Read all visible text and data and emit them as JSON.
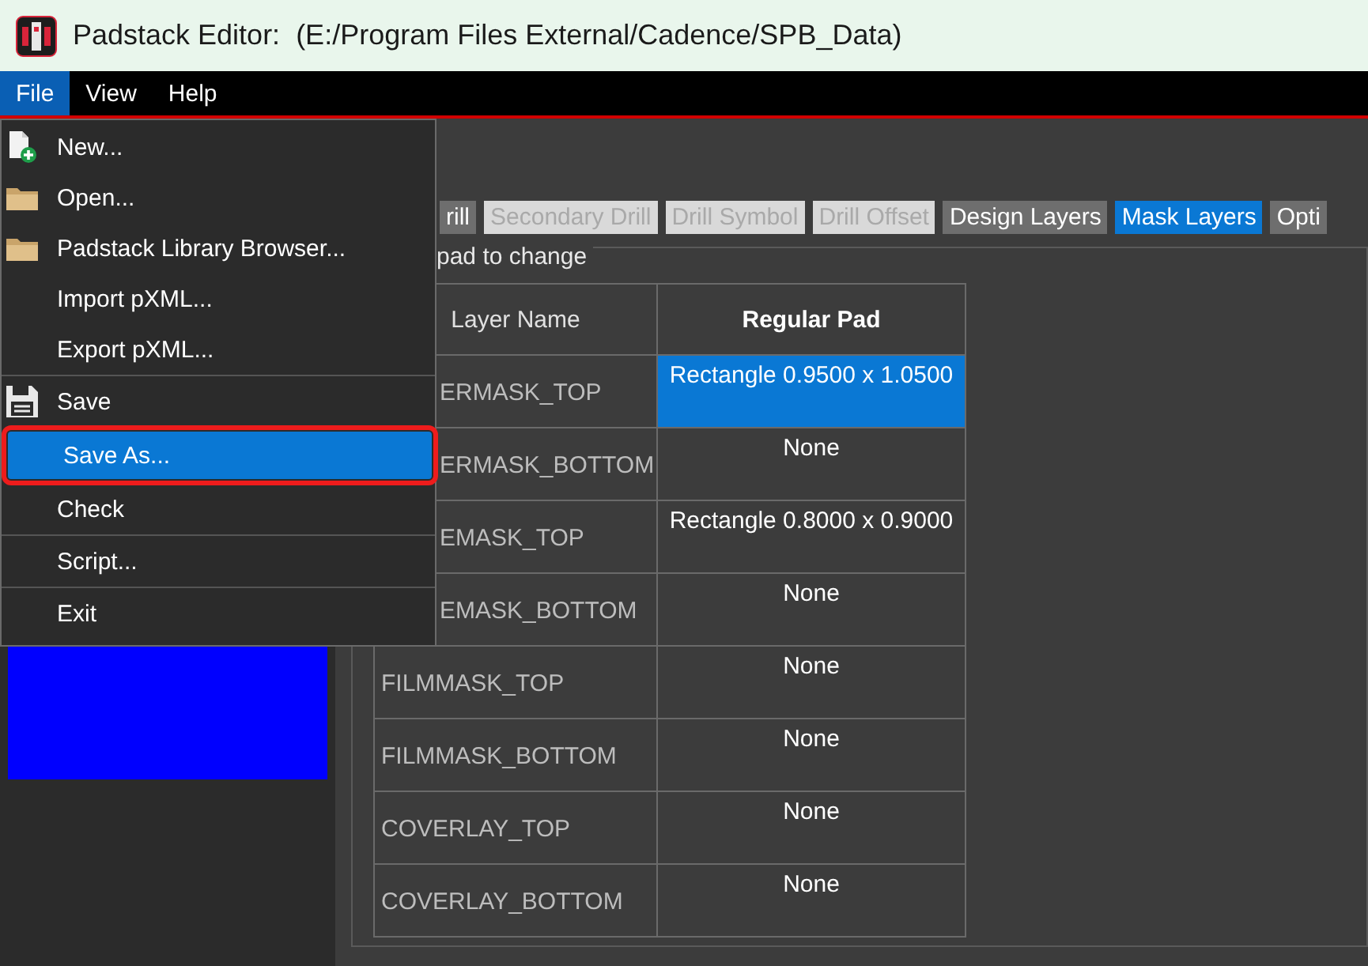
{
  "window": {
    "title": "Padstack Editor:  (E:/Program Files External/Cadence/SPB_Data)"
  },
  "menubar": [
    {
      "label": "File",
      "selected": true
    },
    {
      "label": "View",
      "selected": false
    },
    {
      "label": "Help",
      "selected": false
    }
  ],
  "file_menu": {
    "sections": [
      [
        {
          "label": "New...",
          "kind": "new",
          "selected": false,
          "outlined": false
        },
        {
          "label": "Open...",
          "kind": "folder",
          "selected": false,
          "outlined": false
        },
        {
          "label": "Padstack Library Browser...",
          "kind": "folder",
          "selected": false,
          "outlined": false
        },
        {
          "label": "Import pXML...",
          "kind": "plain",
          "selected": false,
          "outlined": false
        },
        {
          "label": "Export pXML...",
          "kind": "plain",
          "selected": false,
          "outlined": false
        }
      ],
      [
        {
          "label": "Save",
          "kind": "save",
          "selected": false,
          "outlined": false
        },
        {
          "label": "Save As...",
          "kind": "plain",
          "selected": true,
          "outlined": true
        },
        {
          "label": "Check",
          "kind": "plain",
          "selected": false,
          "outlined": false
        }
      ],
      [
        {
          "label": "Script...",
          "kind": "plain",
          "selected": false,
          "outlined": false
        }
      ],
      [
        {
          "label": "Exit",
          "kind": "plain",
          "selected": false,
          "outlined": false
        }
      ]
    ]
  },
  "tabs": [
    {
      "label": "rill",
      "selected": false,
      "disabled": false
    },
    {
      "label": "Secondary Drill",
      "selected": false,
      "disabled": true
    },
    {
      "label": "Drill Symbol",
      "selected": false,
      "disabled": true
    },
    {
      "label": "Drill Offset",
      "selected": false,
      "disabled": true
    },
    {
      "label": "Design Layers",
      "selected": false,
      "disabled": false
    },
    {
      "label": "Mask Layers",
      "selected": true,
      "disabled": false
    },
    {
      "label": "Opti",
      "selected": false,
      "disabled": false
    }
  ],
  "group_label": "pad to change",
  "table": {
    "columns": [
      "Layer Name",
      "Regular Pad"
    ],
    "rows": [
      {
        "layer": "ERMASK_TOP",
        "cut": true,
        "pad": "Rectangle 0.9500 x 1.0500",
        "selected": true
      },
      {
        "layer": "ERMASK_BOTTOM",
        "cut": true,
        "pad": "None",
        "selected": false
      },
      {
        "layer": "EMASK_TOP",
        "cut": true,
        "pad": "Rectangle 0.8000 x 0.9000",
        "selected": false
      },
      {
        "layer": "EMASK_BOTTOM",
        "cut": true,
        "pad": "None",
        "selected": false
      },
      {
        "layer": "FILMMASK_TOP",
        "cut": false,
        "pad": "None",
        "selected": false
      },
      {
        "layer": "FILMMASK_BOTTOM",
        "cut": false,
        "pad": "None",
        "selected": false
      },
      {
        "layer": "COVERLAY_TOP",
        "cut": false,
        "pad": "None",
        "selected": false
      },
      {
        "layer": "COVERLAY_BOTTOM",
        "cut": false,
        "pad": "None",
        "selected": false
      }
    ]
  }
}
